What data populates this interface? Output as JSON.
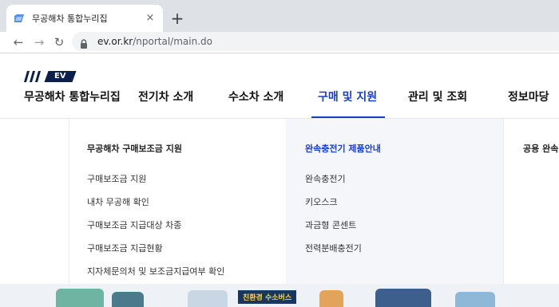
{
  "browser": {
    "tab_title": "무공해차 통합누리집",
    "close_glyph": "×",
    "new_tab_glyph": "+",
    "url_domain": "ev.or.kr",
    "url_path": "/nportal/main.do",
    "back_glyph": "←",
    "forward_glyph": "→",
    "reload_glyph": "↻"
  },
  "site": {
    "logo_badge": "EV",
    "logo_text": "무공해차 통합누리집"
  },
  "gnb": [
    {
      "label": "전기차 소개"
    },
    {
      "label": "수소차 소개"
    },
    {
      "label": "구매 및 지원"
    },
    {
      "label": "관리 및 조회"
    },
    {
      "label": "정보마당"
    }
  ],
  "mega_menu": {
    "col1": {
      "title": "무공해차 구매보조금 지원",
      "items": [
        "구매보조금 지원",
        "내차 무공해 확인",
        "구매보조금 지급대상 차종",
        "구매보조금 지급현황",
        "지자체문의처 및 보조금지급여부 확인"
      ]
    },
    "col2": {
      "title": "완속충전기 제품안내",
      "items": [
        "완속충전기",
        "키오스크",
        "과금형 콘센트",
        "전력분배충전기"
      ]
    },
    "col3": {
      "title": "공용 완속"
    }
  },
  "banner": {
    "sign_text": "친환경 수소버스"
  },
  "colors": {
    "accent": "#1a3cc8",
    "logo_navy": "#0b1f49"
  }
}
